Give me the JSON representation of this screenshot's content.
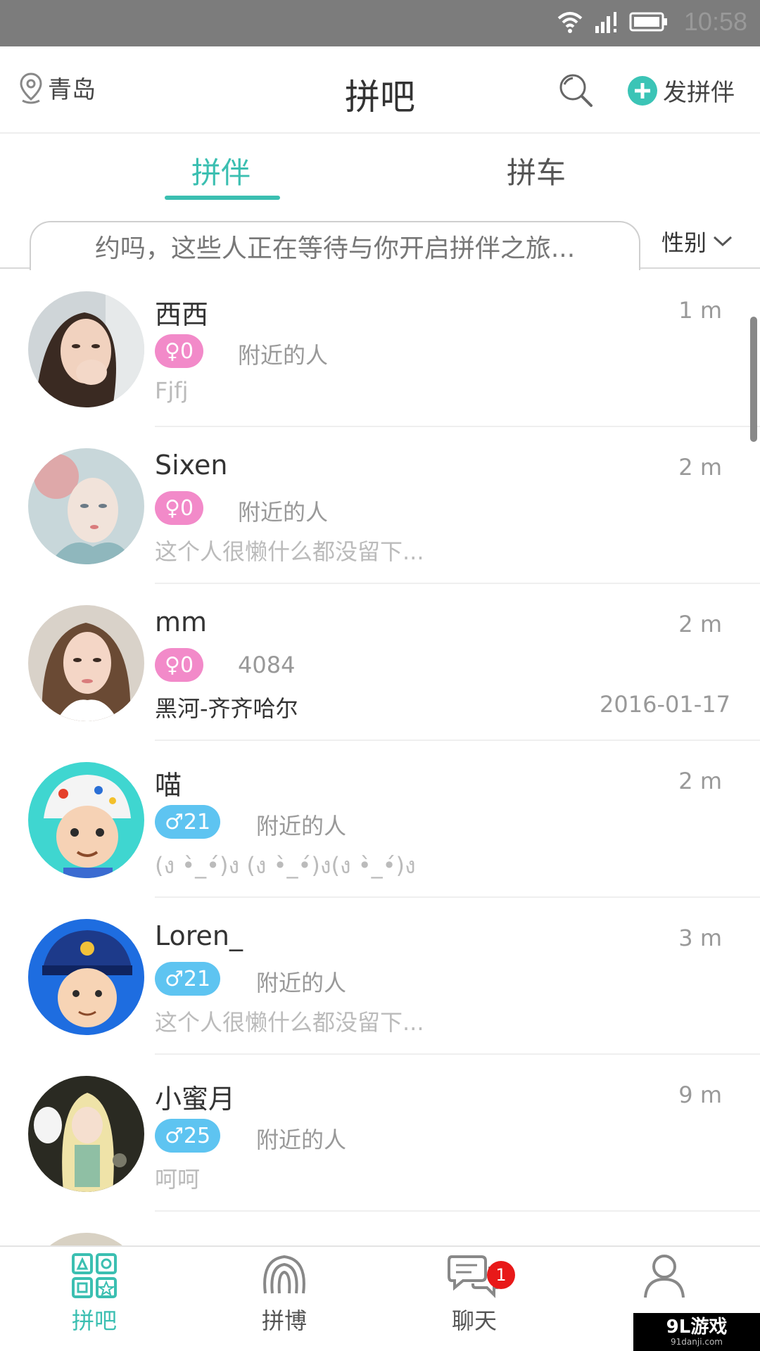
{
  "status_bar": {
    "time": "10:58"
  },
  "header": {
    "location": "青岛",
    "title": "拼吧",
    "add_label": "发拼伴"
  },
  "tabs": [
    {
      "label": "拼伴",
      "active": true
    },
    {
      "label": "拼车",
      "active": false
    }
  ],
  "filter": {
    "banner_text": "约吗，这些人正在等待与你开启拼伴之旅...",
    "gender_label": "性别"
  },
  "list": [
    {
      "name": "西西",
      "time": "1 m",
      "gender": "female",
      "badge": "♀0",
      "distance": "附近的人",
      "sign": "Fjfj",
      "date": ""
    },
    {
      "name": "Sixen",
      "time": "2 m",
      "gender": "female",
      "badge": "♀0",
      "distance": "附近的人",
      "sign": "这个人很懒什么都没留下...",
      "date": ""
    },
    {
      "name": "mm",
      "time": "2 m",
      "gender": "female",
      "badge": "♀0",
      "distance": "4084",
      "sign": "黑河-齐齐哈尔",
      "date": "2016-01-17"
    },
    {
      "name": "喵",
      "time": "2 m",
      "gender": "male",
      "badge": "♂21",
      "distance": "附近的人",
      "sign": "(ง •̀_•́)ง (ง •̀_•́)ง(ง •̀_•́)ง",
      "date": ""
    },
    {
      "name": "Loren_",
      "time": "3 m",
      "gender": "male",
      "badge": "♂21",
      "distance": "附近的人",
      "sign": "这个人很懒什么都没留下...",
      "date": ""
    },
    {
      "name": "小蜜月",
      "time": "9 m",
      "gender": "male",
      "badge": "♂25",
      "distance": "附近的人",
      "sign": "呵呵",
      "date": ""
    }
  ],
  "bottom_nav": [
    {
      "label": "拼吧",
      "icon": "grid-apps-icon",
      "active": true
    },
    {
      "label": "拼博",
      "icon": "broadcast-icon",
      "active": false
    },
    {
      "label": "聊天",
      "icon": "chat-bubbles-icon",
      "active": false,
      "badge": "1"
    },
    {
      "label": "",
      "icon": "person-icon",
      "active": false
    }
  ],
  "watermark": {
    "main": "9L游戏",
    "sub": "91danji.com"
  },
  "colors": {
    "accent": "#3bbfb1",
    "female": "#f28ac9",
    "male": "#5ec4f1",
    "notification": "#e81919"
  }
}
